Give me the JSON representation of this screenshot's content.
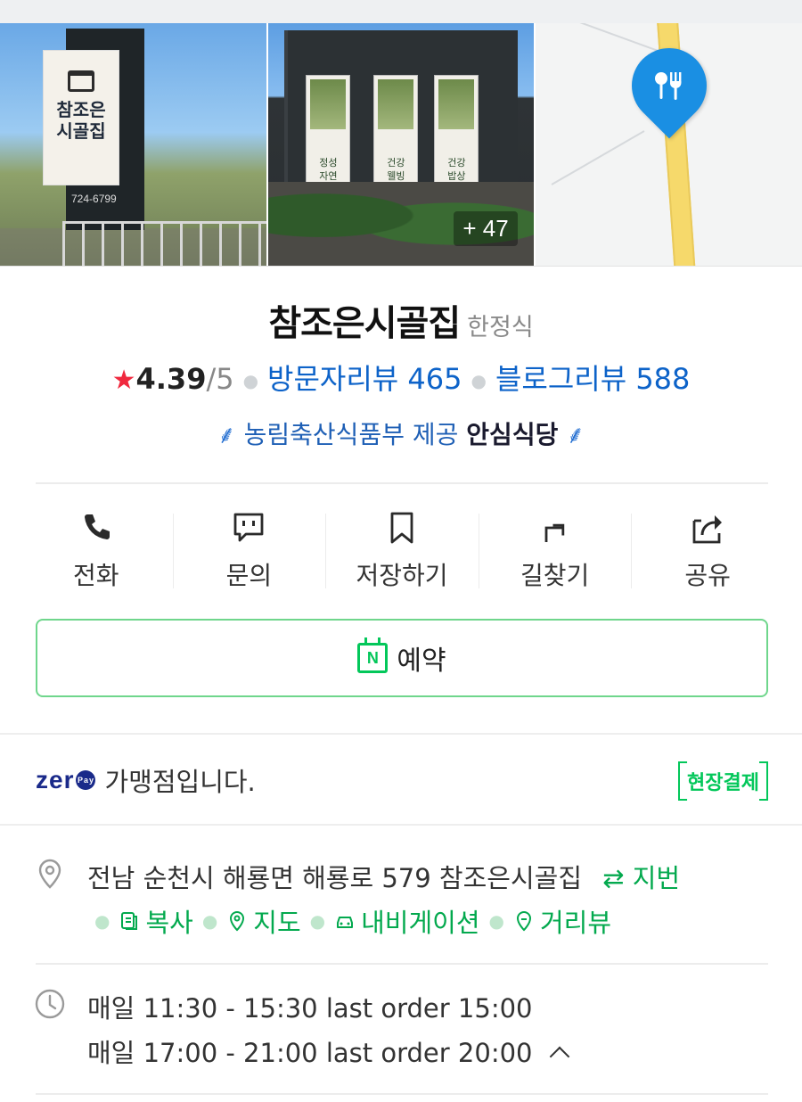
{
  "photos": {
    "sign_text": "참조은\n시골집",
    "sign_phone": "724-6799",
    "banner_texts": [
      "정성\n자연",
      "건강\n웰빙",
      "건강\n밥상"
    ],
    "more_count": "+ 47"
  },
  "place": {
    "name": "참조은시골집",
    "category": "한정식"
  },
  "rating": {
    "score": "4.39",
    "max": "/5",
    "visitor_reviews": "방문자리뷰 465",
    "blog_reviews": "블로그리뷰 588"
  },
  "badge": {
    "provider": "농림축산식품부 제공",
    "name": "안심식당"
  },
  "actions": [
    {
      "label": "전화",
      "icon": "phone-icon"
    },
    {
      "label": "문의",
      "icon": "chat-icon"
    },
    {
      "label": "저장하기",
      "icon": "bookmark-icon"
    },
    {
      "label": "길찾기",
      "icon": "directions-icon"
    },
    {
      "label": "공유",
      "icon": "share-icon"
    }
  ],
  "reserve": {
    "icon_letter": "N",
    "label": "예약"
  },
  "zeropay": {
    "logo": "zer",
    "pay": "Pay",
    "text": "가맹점입니다.",
    "onsite_label": "현장결제"
  },
  "address": {
    "text": "전남 순천시 해룡면 해룡로 579 참조은시골집",
    "lot_toggle": "⇄ 지번",
    "copy": "복사",
    "map": "지도",
    "navigation": "내비게이션",
    "street_view": "거리뷰"
  },
  "hours": {
    "line1": "매일 11:30 - 15:30 last order 15:00",
    "line2": "매일 17:00 - 21:00 last order 20:00"
  },
  "colors": {
    "naver_green": "#03c75a",
    "link_blue": "#0d63c9",
    "star_red": "#f0293e",
    "pin_blue": "#1a8fe3",
    "zeropay_navy": "#1a2a8a"
  }
}
